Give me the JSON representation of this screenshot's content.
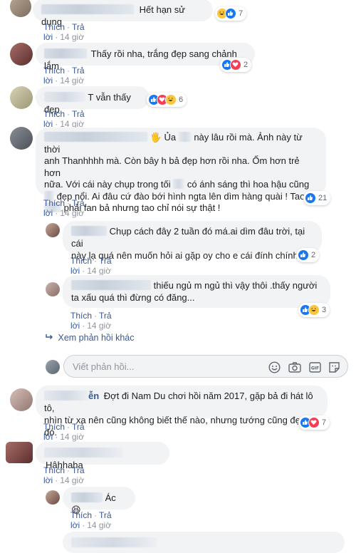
{
  "labels": {
    "like": "Thích",
    "reply": "Trả lời",
    "sep": "·"
  },
  "comments": [
    {
      "text": "Hết hạn sử dụng",
      "time": "14 giờ",
      "reactions": [
        "haha",
        "like"
      ],
      "count": "7"
    },
    {
      "text": "Thấy rồi nha, trắng đẹp sang chảnh lắm",
      "time": "14 giờ",
      "reactions": [
        "like",
        "love"
      ],
      "count": "2"
    },
    {
      "text": "T vẫn thấy đẹp",
      "time": "14 giờ",
      "reactions": [
        "like",
        "love",
        "haha"
      ],
      "count": "6"
    },
    {
      "line1": "Ủa",
      "line1b": "này lâu rồi mà. Ảnh này từ thời",
      "line2": "anh Thanhhhh mà. Còn bây h bả đẹp hơn rồi nha. Ốm hơn trẻ hơn",
      "line3": "nữa. Với cái này chụp trong tối",
      "line3b": "có ánh sáng thì hoa hậu cũng",
      "line4": "đẹp nổi. Ai đâu cứ đào bới hình ngta lên dìm hàng quài ! Tao",
      "line5": "phải fan bả nhưng tao chỉ nói sự thật !",
      "time": "14 giờ",
      "reactions": [
        "like"
      ],
      "count": "21"
    }
  ],
  "replies": [
    {
      "line1": "Chụp cách đây 2 tuần đó má.ai dìm đâu trời, tại cái",
      "line2": "này lạ quá nên muốn hỏi ai gặp oy cho e cái đính chính",
      "emoji": "❤️",
      "time": "14 giờ",
      "reactions": [
        "like"
      ],
      "count": "2"
    },
    {
      "line1": "thiếu ngủ m ngủ thì vậy thôi .thấy người",
      "line2": "ta xấu quá thì đừng có đăng...",
      "time": "14 giờ",
      "reactions": [
        "like",
        "haha"
      ],
      "count": "3"
    }
  ],
  "more_replies": "Xem phản hồi khác",
  "reply_placeholder": "Viết phản hồi...",
  "comments2": [
    {
      "name_tail": "ễn",
      "line1": "Đợt đi Nam Du chơi hồi năm 2017, gặp bả đi hát lô tô,",
      "line2": "nhìn từ xa nên cũng không biết thế nào, nhưng tướng cũng đẹp đó.",
      "time": "14 giờ",
      "reactions": [
        "like",
        "love"
      ],
      "count": "7"
    },
    {
      "text": "Hâhhaha",
      "time": "14 giờ"
    }
  ],
  "last_reply": {
    "text": "Ác",
    "emoji": "😆",
    "time": "14 giờ"
  },
  "colors": {
    "link": "#385898",
    "meta": "#90949c",
    "bubble": "#f2f3f5",
    "like": "#1877f2",
    "love": "#f33e58",
    "haha": "#f7c73e"
  }
}
